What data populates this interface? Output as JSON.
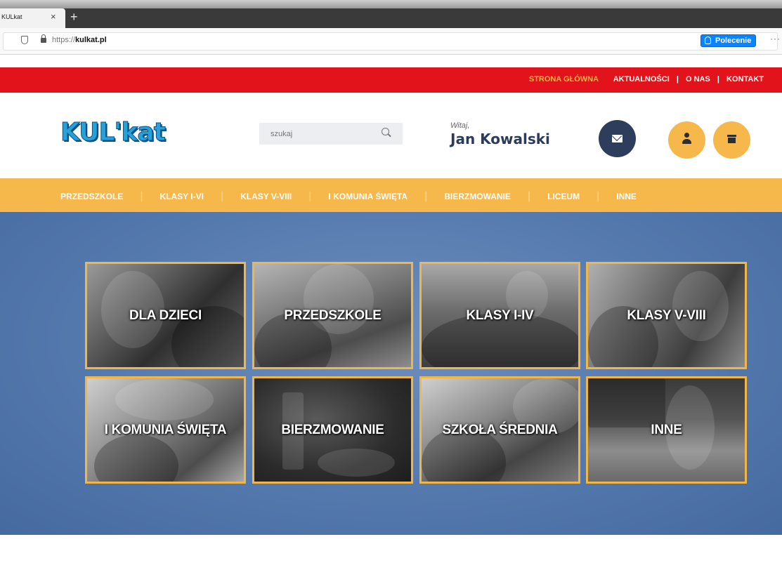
{
  "browser": {
    "tab_title": "KULkat",
    "tab_close": "×",
    "new_tab": "+",
    "url_prefix": "https://",
    "url_domain": "kulkat.pl",
    "recommend_button": "Polecenie",
    "more_menu": "···"
  },
  "topbar": {
    "links": [
      "STRONA GŁÓWNA",
      "AKTUALNOŚCI",
      "O NAS",
      "KONTAKT"
    ],
    "separator": "|",
    "color": "#e2131a",
    "active_color": "#f7b84b"
  },
  "header": {
    "logo": "KUL'kat",
    "search_placeholder": "szukaj",
    "welcome": "Witaj,",
    "user_name": "Jan Kowalski"
  },
  "catnav": {
    "items": [
      "PRZEDSZKOLE",
      "KLASY I-VI",
      "KLASY V-VIII",
      "I KOMUNIA ŚWIĘTA",
      "BIERZMOWANIE",
      "LICEUM",
      "INNE"
    ],
    "separator": "|",
    "color": "#f7b84b"
  },
  "tiles": [
    {
      "label": "DLA DZIECI"
    },
    {
      "label": "PRZEDSZKOLE"
    },
    {
      "label": "KLASY I-IV"
    },
    {
      "label": "KLASY V-VIII"
    },
    {
      "label": "I KOMUNIA ŚWIĘTA"
    },
    {
      "label": "BIERZMOWANIE"
    },
    {
      "label": "SZKOŁA ŚREDNIA"
    },
    {
      "label": "INNE"
    }
  ],
  "icons": {
    "shield": "shield-icon",
    "lock": "lock-icon",
    "bulb": "bulb-icon",
    "search": "search-icon",
    "mail": "mail-icon",
    "user": "user-icon",
    "archive": "archive-icon"
  }
}
